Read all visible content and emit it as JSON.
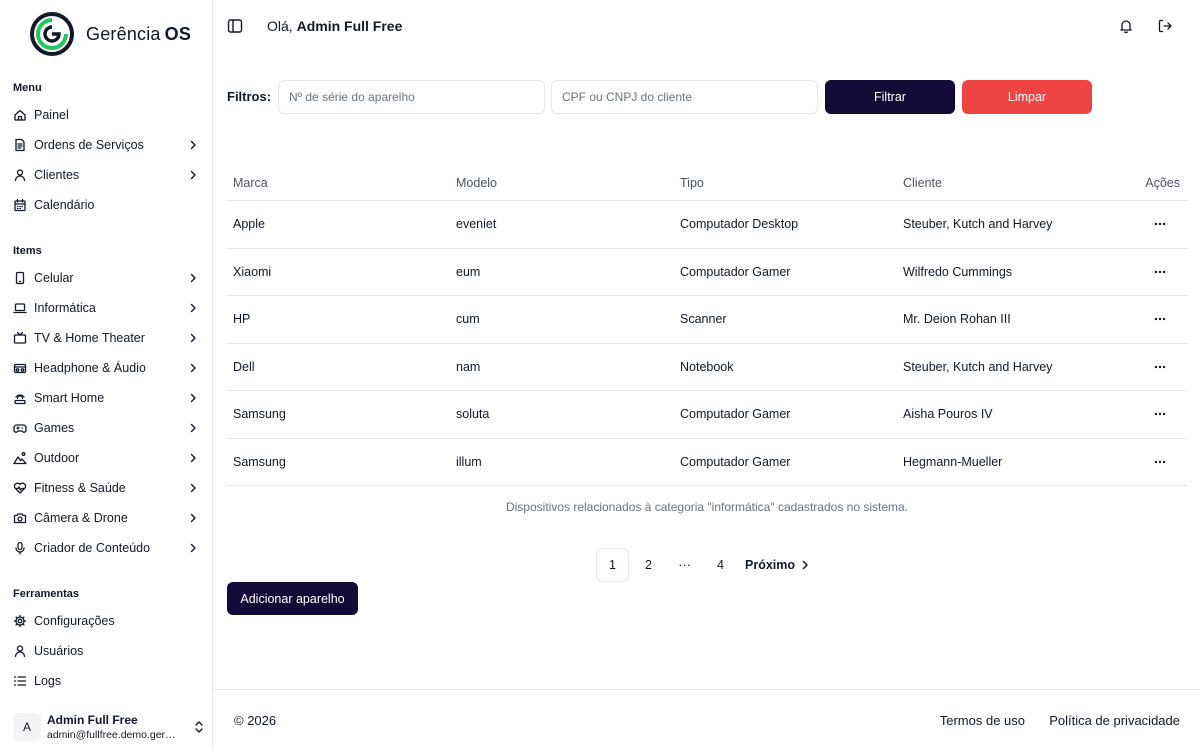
{
  "brand": {
    "name_prefix": "Gerência",
    "name_suffix": "OS"
  },
  "sidebar": {
    "sections": [
      {
        "label": "Menu",
        "items": [
          {
            "label": "Painel",
            "icon": "home-icon",
            "chevron": false
          },
          {
            "label": "Ordens de Serviços",
            "icon": "document-icon",
            "chevron": true
          },
          {
            "label": "Clientes",
            "icon": "user-icon",
            "chevron": true
          },
          {
            "label": "Calendário",
            "icon": "calendar-icon",
            "chevron": false
          }
        ]
      },
      {
        "label": "Items",
        "items": [
          {
            "label": "Celular",
            "icon": "phone-icon",
            "chevron": true
          },
          {
            "label": "Informática",
            "icon": "laptop-icon",
            "chevron": true
          },
          {
            "label": "TV & Home Theater",
            "icon": "tv-icon",
            "chevron": true
          },
          {
            "label": "Headphone & Áudio",
            "icon": "speaker-icon",
            "chevron": true
          },
          {
            "label": "Smart Home",
            "icon": "smart-home-icon",
            "chevron": true
          },
          {
            "label": "Games",
            "icon": "gamepad-icon",
            "chevron": true
          },
          {
            "label": "Outdoor",
            "icon": "outdoor-icon",
            "chevron": true
          },
          {
            "label": "Fitness & Saúde",
            "icon": "heart-pulse-icon",
            "chevron": true
          },
          {
            "label": "Câmera & Drone",
            "icon": "camera-icon",
            "chevron": true
          },
          {
            "label": "Criador de Conteúdo",
            "icon": "microphone-icon",
            "chevron": true
          }
        ]
      },
      {
        "label": "Ferramentas",
        "items": [
          {
            "label": "Configurações",
            "icon": "gear-icon",
            "chevron": false
          },
          {
            "label": "Usuários",
            "icon": "user-icon",
            "chevron": false
          },
          {
            "label": "Logs",
            "icon": "list-icon",
            "chevron": false
          }
        ]
      }
    ]
  },
  "user": {
    "initial": "A",
    "name": "Admin Full Free",
    "email": "admin@fullfree.demo.gerenciaos.com"
  },
  "header": {
    "greeting_prefix": "Olá,",
    "greeting_name": "Admin Full Free"
  },
  "filters": {
    "label": "Filtros:",
    "serial_placeholder": "Nº de série do aparelho",
    "serial_value": "",
    "client_placeholder": "CPF ou CNPJ do cliente",
    "client_value": "",
    "filter_button": "Filtrar",
    "clear_button": "Limpar"
  },
  "table": {
    "headers": [
      "Marca",
      "Modelo",
      "Tipo",
      "Cliente",
      "Ações"
    ],
    "rows": [
      [
        "Apple",
        "eveniet",
        "Computador Desktop",
        "Steuber, Kutch and Harvey"
      ],
      [
        "Xiaomi",
        "eum",
        "Computador Gamer",
        "Wilfredo Cummings"
      ],
      [
        "HP",
        "cum",
        "Scanner",
        "Mr. Deion Rohan III"
      ],
      [
        "Dell",
        "nam",
        "Notebook",
        "Steuber, Kutch and Harvey"
      ],
      [
        "Samsung",
        "soluta",
        "Computador Gamer",
        "Aisha Pouros IV"
      ],
      [
        "Samsung",
        "illum",
        "Computador Gamer",
        "Hegmann-Mueller"
      ]
    ],
    "caption": "Dispositivos relacionados à categoria \"informática\" cadastrados no sistema."
  },
  "pagination": {
    "pages": [
      "1",
      "2",
      "4"
    ],
    "current": "1",
    "ellipsis": "···",
    "next_label": "Próximo"
  },
  "add_button": "Adicionar aparelho",
  "footer": {
    "copyright": "© 2026",
    "terms": "Termos de uso",
    "privacy": "Política de privacidade"
  },
  "colors": {
    "primary": "#130a38",
    "danger": "#ef4444",
    "brand_green": "#22c55e",
    "border": "#e5e7eb"
  }
}
